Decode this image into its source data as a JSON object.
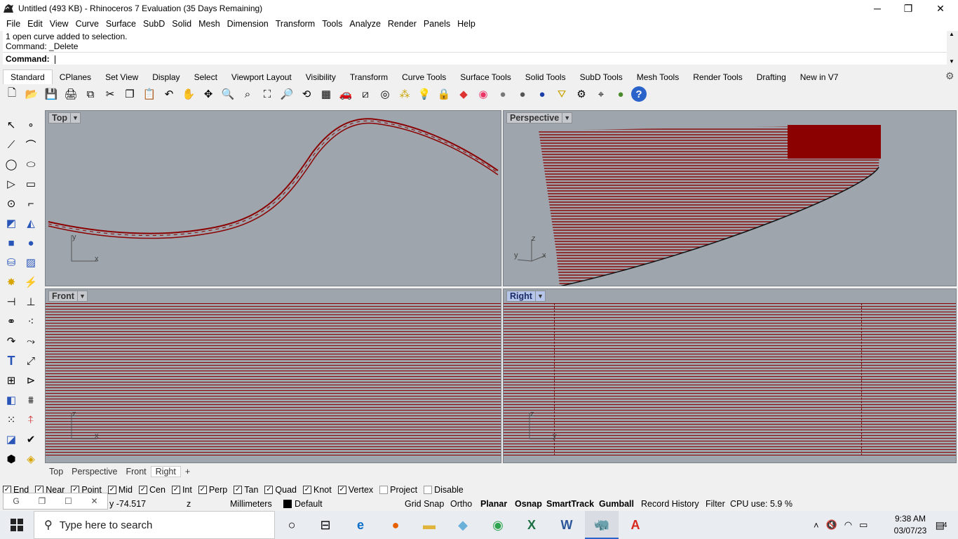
{
  "window": {
    "title": "Untitled (493 KB) - Rhinoceros 7 Evaluation (35 Days Remaining)",
    "minimize": "─",
    "restore": "❐",
    "close": "✕"
  },
  "menu": [
    "File",
    "Edit",
    "View",
    "Curve",
    "Surface",
    "SubD",
    "Solid",
    "Mesh",
    "Dimension",
    "Transform",
    "Tools",
    "Analyze",
    "Render",
    "Panels",
    "Help"
  ],
  "command": {
    "history": [
      "1 open curve added to selection.",
      "Command: _Delete"
    ],
    "prompt_label": "Command:",
    "value": ""
  },
  "toolbar_tabs": [
    "Standard",
    "CPlanes",
    "Set View",
    "Display",
    "Select",
    "Viewport Layout",
    "Visibility",
    "Transform",
    "Curve Tools",
    "Surface Tools",
    "Solid Tools",
    "SubD Tools",
    "Mesh Tools",
    "Render Tools",
    "Drafting",
    "New in V7"
  ],
  "active_toolbar_tab": "Standard",
  "toolbar_icons": [
    "new-icon",
    "open-icon",
    "save-icon",
    "print-icon",
    "import-icon",
    "cut-icon",
    "copy-icon",
    "paste-icon",
    "undo-icon",
    "pan-icon",
    "rotate-icon",
    "zoom-icon",
    "zoom-window-icon",
    "zoom-extents-icon",
    "zoom-selected-icon",
    "rotate-view-icon",
    "four-view-icon",
    "car-icon",
    "cplane-icon",
    "grid-icon",
    "points-icon",
    "light-icon",
    "lock-icon",
    "layer-icon",
    "color-wheel-icon",
    "material-ball-icon",
    "render-sphere-icon",
    "render-blue-icon",
    "filter-icon",
    "options-icon",
    "snap-icon",
    "environment-icon",
    "help-icon"
  ],
  "side_icons": [
    "select-icon",
    "point-icon",
    "polyline-icon",
    "curve-icon",
    "circle-icon",
    "ellipse-icon",
    "polygon-icon",
    "rectangle-icon",
    "arc-icon",
    "fillet-curve-icon",
    "surface-pt-icon",
    "surface-edit-icon",
    "box-icon",
    "sphere-icon",
    "cylinder-icon",
    "mesh-icon",
    "boolean-icon",
    "explode-icon",
    "split-icon",
    "trim-icon",
    "group-icon",
    "ungroup-icon",
    "sweep-icon",
    "revolve-icon",
    "text-icon",
    "dimension-icon",
    "array-icon",
    "analyze-icon",
    "block-icon",
    "fence-icon",
    "grid-array-icon",
    "align-icon",
    "unroll-icon",
    "check-icon",
    "volume-icon",
    "paint-icon"
  ],
  "viewports": {
    "top": {
      "label": "Top",
      "axis_y": "y",
      "axis_x": "x"
    },
    "perspective": {
      "label": "Perspective",
      "axis_z": "z",
      "axis_y": "y",
      "axis_x": "x"
    },
    "front": {
      "label": "Front",
      "axis_z": "z",
      "axis_x": "x"
    },
    "right": {
      "label": "Right",
      "axis_z": "z",
      "axis_y": "y"
    }
  },
  "viewport_tabs": [
    "Top",
    "Perspective",
    "Front",
    "Right"
  ],
  "active_viewport_tab": "Right",
  "add_tab": "+",
  "osnaps": [
    {
      "label": "End",
      "on": true
    },
    {
      "label": "Near",
      "on": true
    },
    {
      "label": "Point",
      "on": true
    },
    {
      "label": "Mid",
      "on": true
    },
    {
      "label": "Cen",
      "on": true
    },
    {
      "label": "Int",
      "on": true
    },
    {
      "label": "Perp",
      "on": true
    },
    {
      "label": "Tan",
      "on": true
    },
    {
      "label": "Quad",
      "on": true
    },
    {
      "label": "Knot",
      "on": true
    },
    {
      "label": "Vertex",
      "on": true
    },
    {
      "label": "Project",
      "on": false
    },
    {
      "label": "Disable",
      "on": false
    }
  ],
  "status": {
    "coord_y": "y -74.517",
    "coord_z": "z",
    "units": "Millimeters",
    "layer": "Default",
    "grid_snap": "Grid Snap",
    "ortho": "Ortho",
    "planar": "Planar",
    "osnap": "Osnap",
    "smarttrack": "SmartTrack",
    "gumball": "Gumball",
    "record_history": "Record History",
    "filter": "Filter",
    "cpu": "CPU use: 5.9 %"
  },
  "mini_window": {
    "label": "G"
  },
  "taskbar": {
    "search_placeholder": "Type here to search",
    "time": "9:38 AM",
    "date": "03/07/23",
    "notifications": "4"
  },
  "colors": {
    "curve": "#8b0000",
    "viewport_bg": "#9ea5ad",
    "active_label": "#b6c6ea"
  }
}
